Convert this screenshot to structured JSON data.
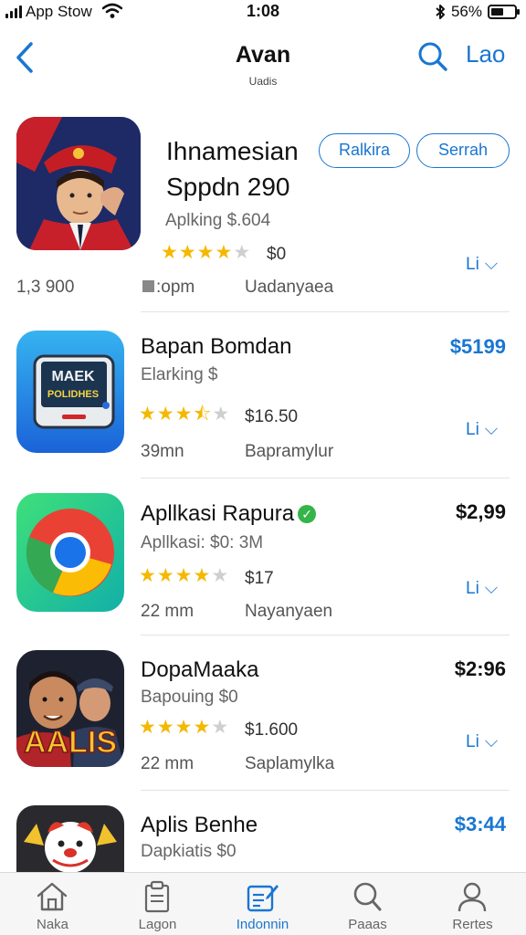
{
  "status_bar": {
    "carrier": "App Stow",
    "time": "1:08",
    "battery": "56%",
    "battery_level": 0.56
  },
  "nav": {
    "title": "Avan",
    "subtitle": "Uadis",
    "right_label": "Lao"
  },
  "featured": {
    "name_line1": "Ihnamesian",
    "name_line2": "Sppdn 290",
    "subtitle": "Aplking $.604",
    "rating": 4,
    "rating_text": "$0",
    "left_meta": "1,3 900",
    "dev_meta": ":opm",
    "category": "Uadanyaea",
    "more": "Li",
    "button_ranking": "Ralkira",
    "button_search": "Serrah"
  },
  "apps": [
    {
      "name": "Bapan Bomdan",
      "subtitle": "Elarking $",
      "price": "$5199",
      "price_color": "#1a76d2",
      "rating": 3.5,
      "rating_text": "$16.50",
      "size": "39mn",
      "category": "Bapramylur",
      "more": "Li",
      "icon_text_top": "MAEK",
      "icon_text_bottom": "POLIDHES"
    },
    {
      "name": "Apllkasi Rapura",
      "subtitle": "Apllkasi: $0: 3M",
      "price": "$2,99",
      "price_color": "#111111",
      "rating": 4,
      "rating_text": "$17",
      "size": "22 mm",
      "category": "Nayanyaen",
      "more": "Li"
    },
    {
      "name": "DopaMaaka",
      "subtitle": "Bapouing $0",
      "price": "$2:96",
      "price_color": "#111111",
      "rating": 4,
      "rating_text": "$1.600",
      "size": "22 mm",
      "category": "Saplamylka",
      "more": "Li",
      "icon_text": "AALIS"
    },
    {
      "name": "Aplis Benhe",
      "subtitle": "Dapkiatis $0",
      "price": "$3:44",
      "price_color": "#1a76d2"
    }
  ],
  "tabs": [
    {
      "label": "Naka",
      "icon": "home-icon"
    },
    {
      "label": "Lagon",
      "icon": "clipboard-icon"
    },
    {
      "label": "Indonnin",
      "icon": "edit-list-icon",
      "active": true
    },
    {
      "label": "Paaas",
      "icon": "search-icon"
    },
    {
      "label": "Rertes",
      "icon": "person-icon"
    }
  ]
}
